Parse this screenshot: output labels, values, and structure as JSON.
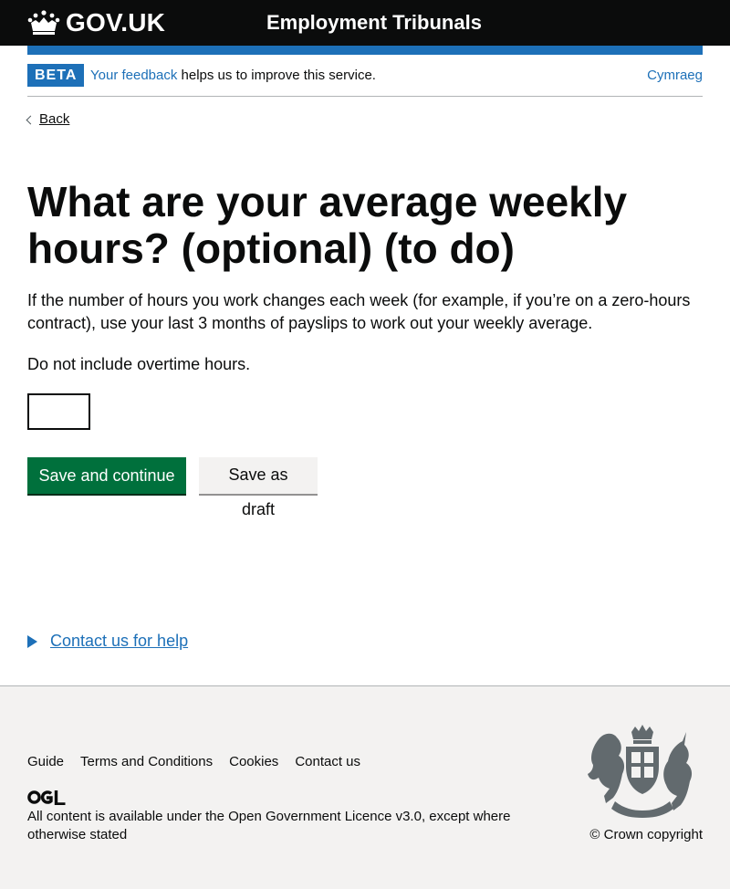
{
  "header": {
    "brand": "GOV.UK",
    "service_name": "Employment Tribunals"
  },
  "phase_banner": {
    "tag": "BETA",
    "feedback_link": "Your feedback",
    "feedback_text": " helps us to improve this service.",
    "language_link": "Cymraeg"
  },
  "back_link": "Back",
  "main": {
    "heading": "What are your average weekly hours? (optional) (to do)",
    "hint": "If the number of hours you work changes each week (for example, if you’re on a zero-hours contract), use your last 3 months of payslips to work out your weekly average.",
    "note": "Do not include overtime hours.",
    "hours_input": {
      "value": "",
      "placeholder": ""
    },
    "primary_button": "Save and continue",
    "secondary_button": "Save as draft"
  },
  "details": {
    "summary": "Contact us for help"
  },
  "footer": {
    "links": [
      "Guide",
      "Terms and Conditions",
      "Cookies",
      "Contact us"
    ],
    "ogl_logo": "OGL",
    "licence_prefix": "All content is available under the ",
    "licence_link": "Open Government Licence v3.0",
    "licence_suffix": ", except where otherwise stated",
    "copyright": "© Crown copyright"
  },
  "colors": {
    "header_bg": "#0b0c0c",
    "brand_blue": "#1d70b8",
    "primary_button": "#00703c",
    "secondary_button": "#f3f2f1",
    "footer_bg": "#f3f2f1"
  },
  "icons": [
    "crown-icon",
    "chevron-left-icon",
    "triangle-right-icon",
    "ogl-logo-icon",
    "royal-coat-of-arms-icon"
  ]
}
